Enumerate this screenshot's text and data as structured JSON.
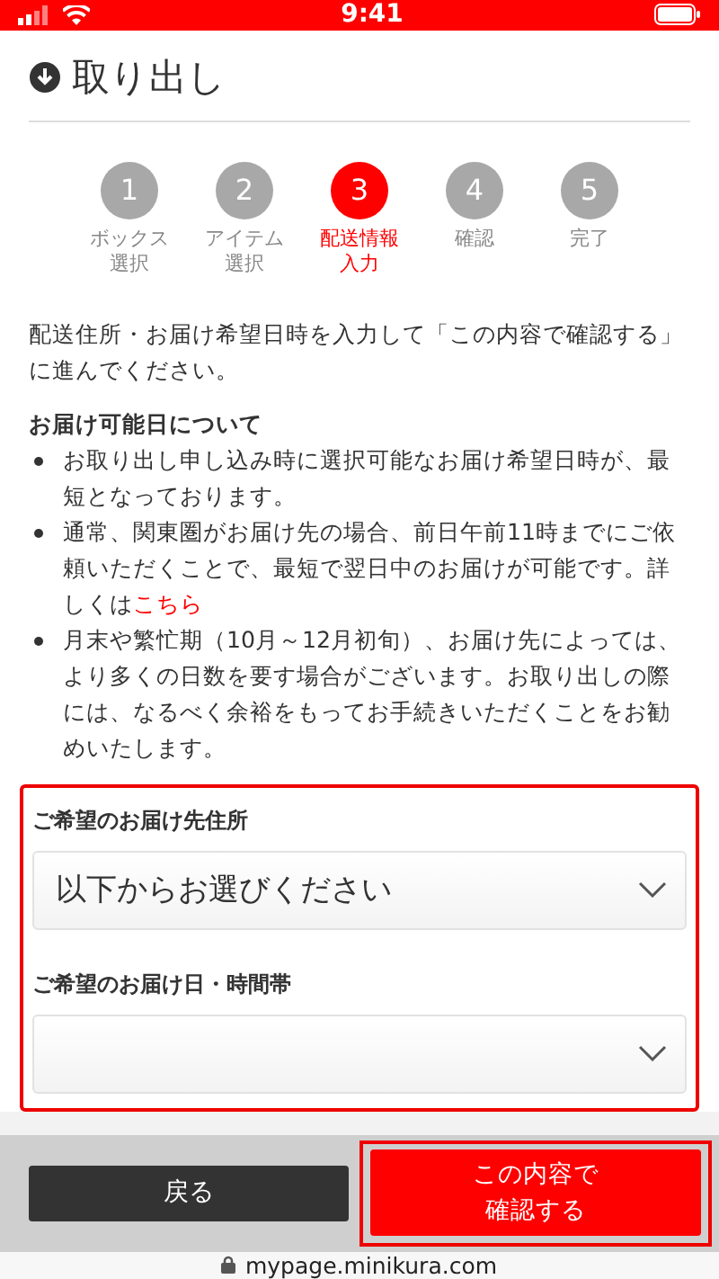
{
  "status_bar": {
    "time": "9:41"
  },
  "page": {
    "title": "取り出し"
  },
  "steps": [
    {
      "number": "1",
      "label": "ボックス選択",
      "selected": false
    },
    {
      "number": "2",
      "label": "アイテム選択",
      "selected": false
    },
    {
      "number": "3",
      "label": "配送情報入力",
      "selected": true
    },
    {
      "number": "4",
      "label": "確認",
      "selected": false
    },
    {
      "number": "5",
      "label": "完了",
      "selected": false
    }
  ],
  "intro": "配送住所・お届け希望日時を入力して「この内容で確認する」に進んでください。",
  "notice": {
    "heading": "お届け可能日について",
    "items": [
      {
        "text": "お取り出し申し込み時に選択可能なお届け希望日時が、最短となっております。"
      },
      {
        "text": "通常、関東圏がお届け先の場合、前日午前11時までにご依頼いただくことで、最短で翌日中のお届けが可能です。詳しくは",
        "link": "こちら"
      },
      {
        "text": "月末や繁忙期（10月～12月初旬）、お届け先によっては、より多くの日数を要す場合がございます。お取り出しの際には、なるべく余裕をもってお手続きいただくことをお勧めいたします。"
      }
    ]
  },
  "form": {
    "highlighted": true,
    "fields": [
      {
        "label": "ご希望のお届け先住所",
        "value": "以下からお選びください"
      },
      {
        "label": "ご希望のお届け日・時間帯"
      }
    ]
  },
  "footer": {
    "back_button": "戻る",
    "confirm_button": "この内容で確認する",
    "confirm_highlighted": true
  },
  "url_bar": {
    "url": "mypage.minikura.com"
  }
}
